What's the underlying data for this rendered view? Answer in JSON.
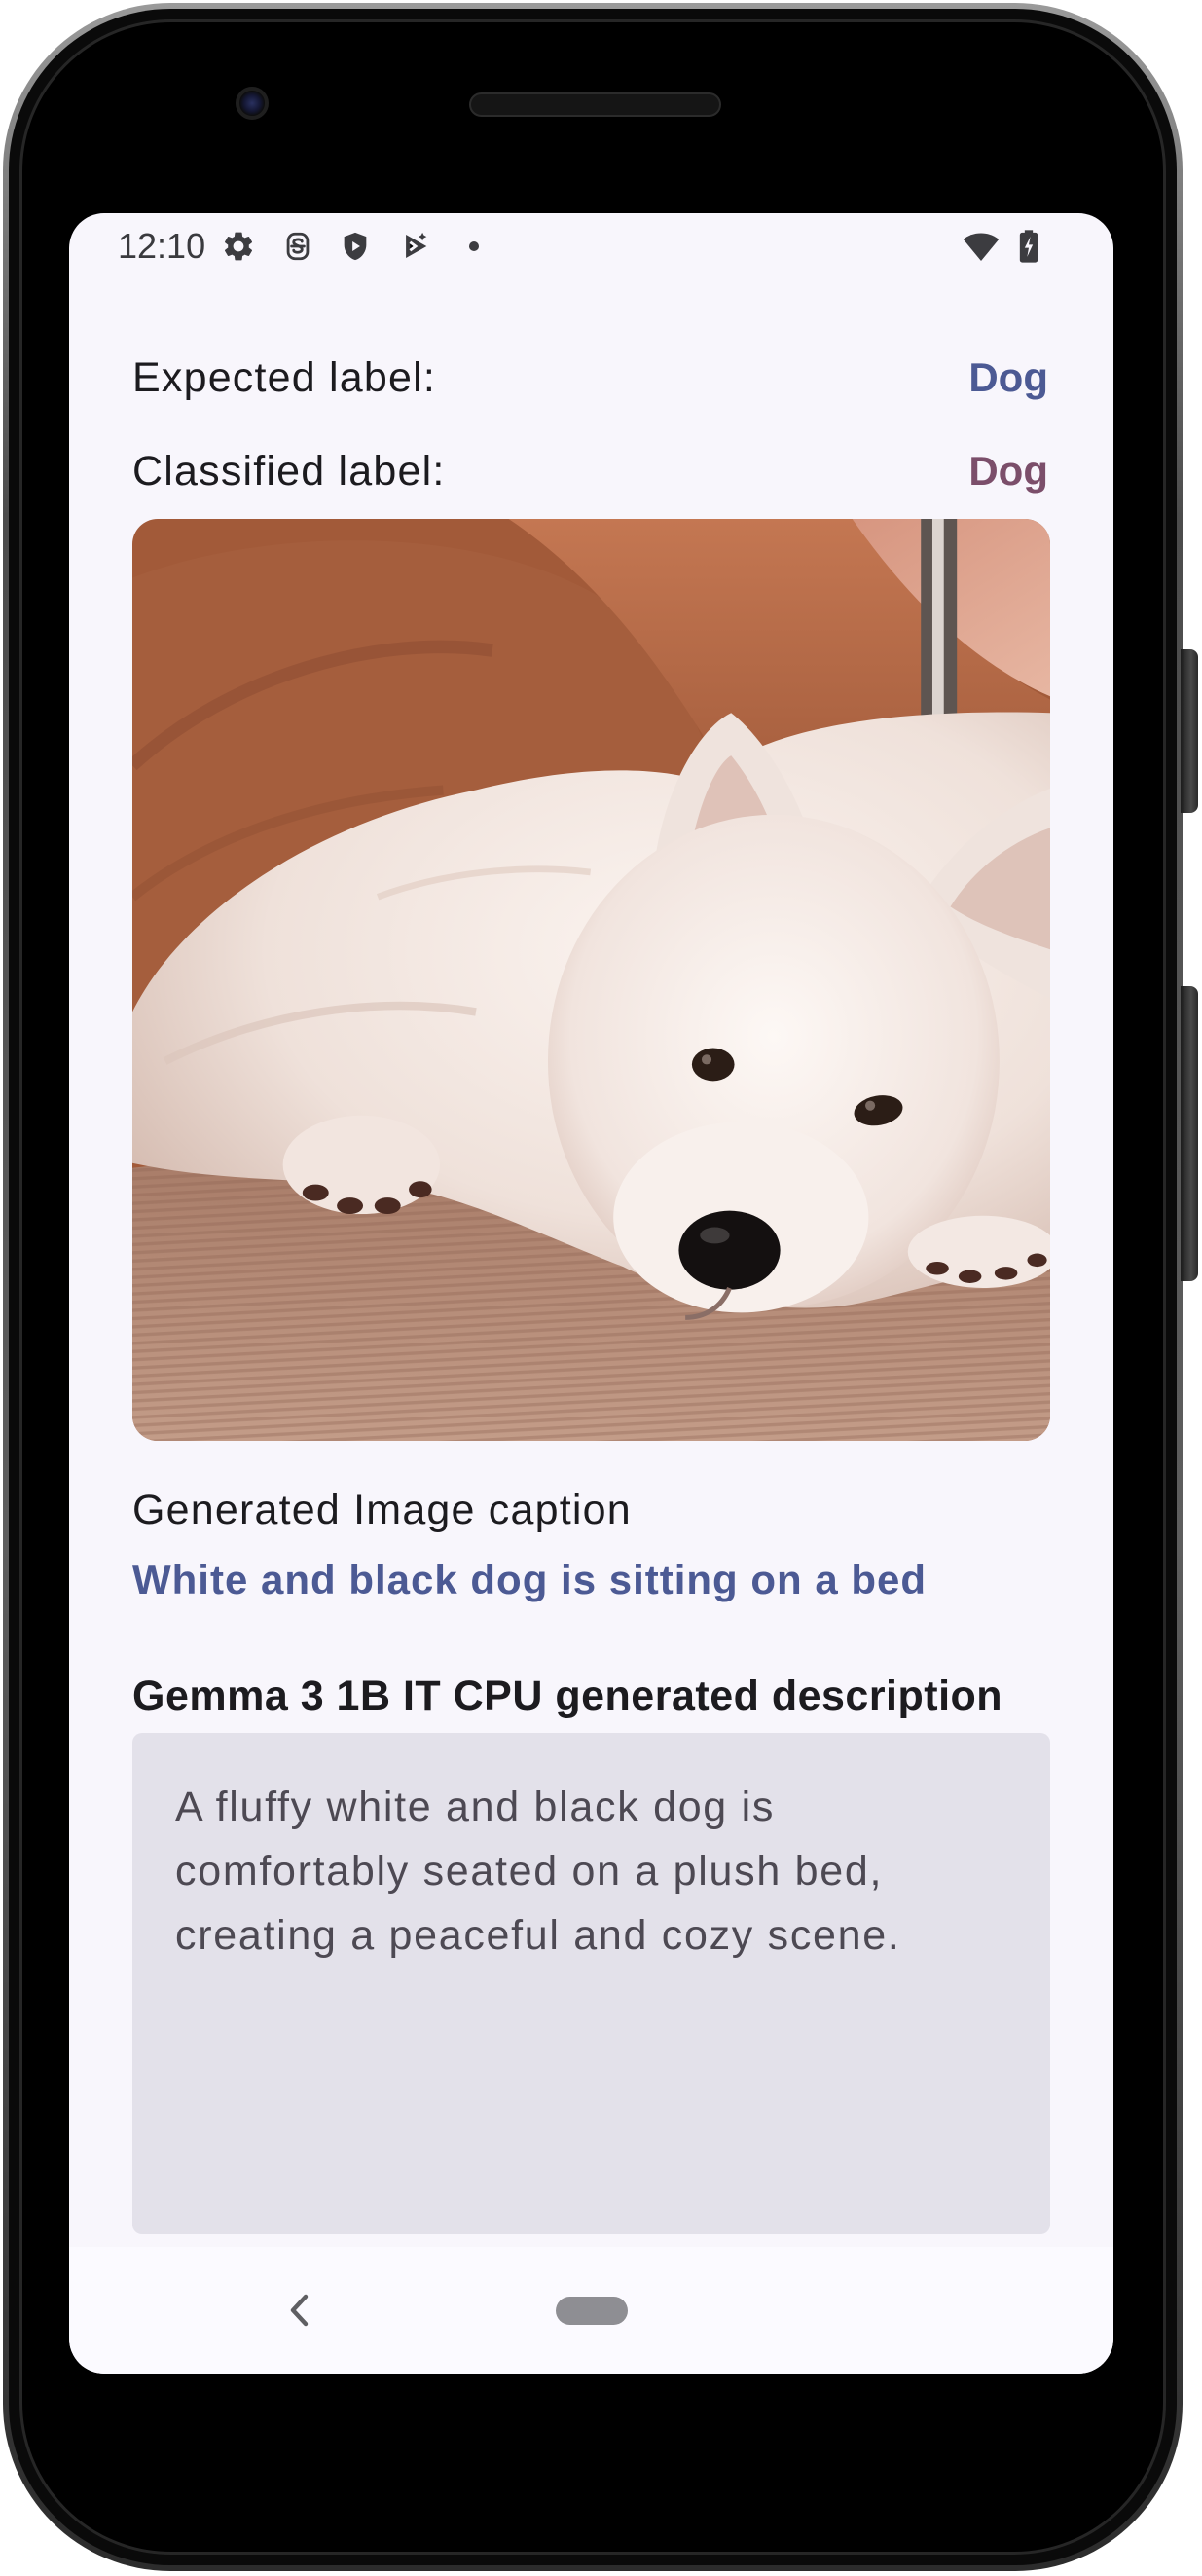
{
  "status_bar": {
    "time": "12:10",
    "left_icons": [
      "settings-gear-icon",
      "notification-s-icon",
      "shield-icon",
      "play-icon",
      "more-notifications-dot-icon"
    ],
    "right_icons": [
      "wifi-icon",
      "battery-charging-icon"
    ]
  },
  "labels": {
    "expected_label": "Expected label:",
    "expected_value": "Dog",
    "classified_label": "Classified label:",
    "classified_value": "Dog"
  },
  "caption": {
    "heading": "Generated Image caption",
    "text": "White and black dog is sitting on a bed"
  },
  "description": {
    "heading": "Gemma 3 1B IT CPU generated description",
    "text": "A fluffy white and black dog is comfortably seated on a plush bed, creating a peaceful and cozy scene."
  },
  "nav_bar": {
    "icons": [
      "back-chevron-icon",
      "home-pill"
    ]
  },
  "colors": {
    "accent": "#4c5a94",
    "accent_secondary": "#7b4e6a",
    "description_box": "#e3e1ea",
    "surface": "#f8f6fc"
  }
}
